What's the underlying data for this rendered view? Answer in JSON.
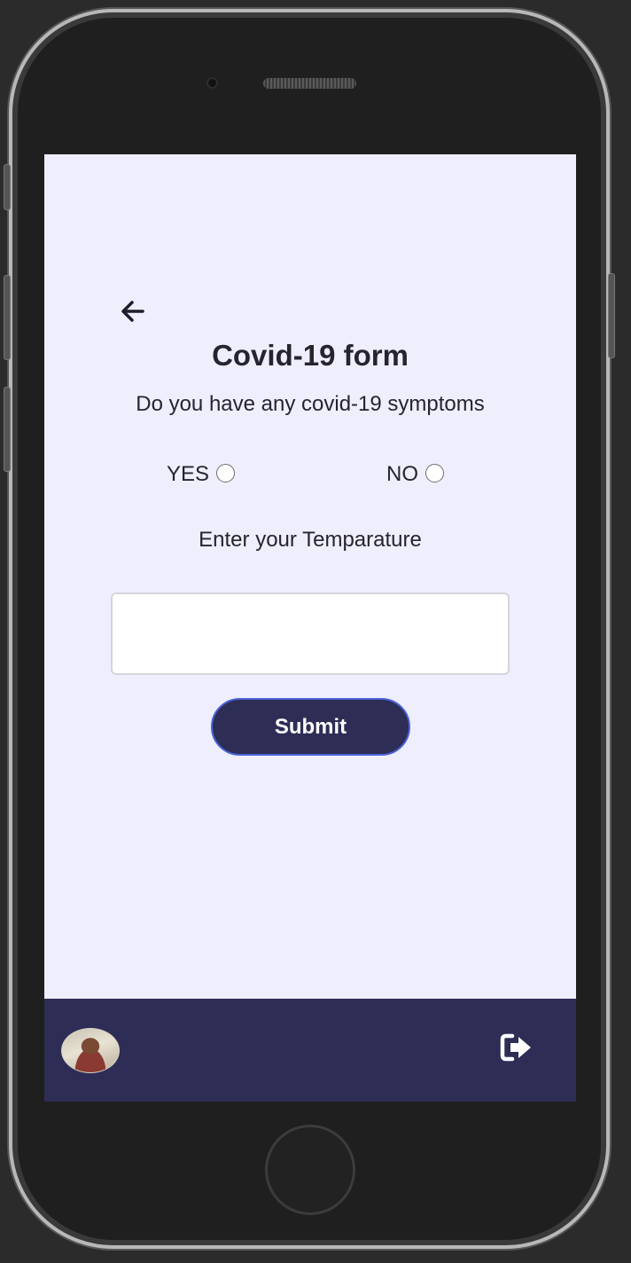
{
  "form": {
    "title": "Covid-19 form",
    "question": "Do you have any covid-19 symptoms",
    "options": {
      "yes": "YES",
      "no": "NO"
    },
    "temperature_label": "Enter your Temparature",
    "temperature_value": "",
    "submit_label": "Submit"
  },
  "icons": {
    "back": "back-arrow-icon",
    "logout": "logout-icon",
    "avatar": "user-avatar"
  },
  "colors": {
    "screen_background": "#efeefd",
    "primary": "#2e2d56",
    "button_border": "#4a63d8",
    "text": "#25242f"
  }
}
